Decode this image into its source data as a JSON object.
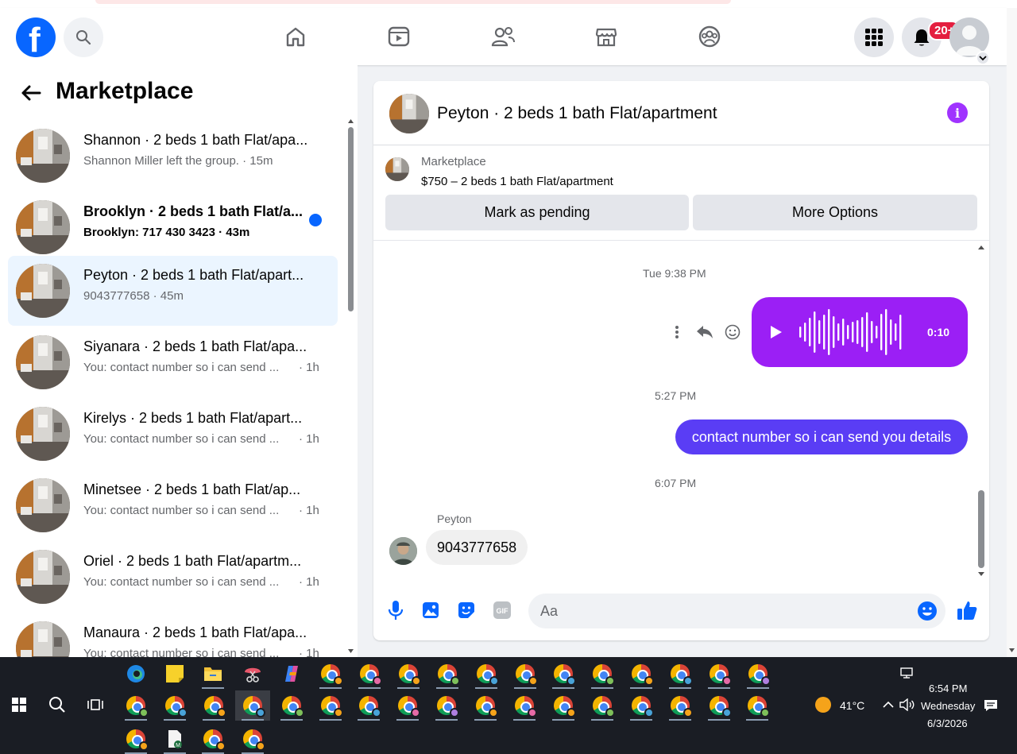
{
  "header": {
    "notifications_badge": "20+",
    "nav_items": [
      "home-icon",
      "video-icon",
      "friends-icon",
      "marketplace-icon",
      "groups-icon"
    ]
  },
  "left_panel": {
    "title": "Marketplace",
    "conversations": [
      {
        "name": "Shannon · 2 beds 1 bath Flat/apa...",
        "preview": "Shannon Miller left the group. · 15m",
        "time": "",
        "unread": false,
        "active": false
      },
      {
        "name": "Brooklyn · 2 beds 1 bath Flat/a...",
        "preview": "Brooklyn: 717 430 3423 · 43m",
        "time": "",
        "unread": true,
        "active": false
      },
      {
        "name": "Peyton · 2 beds 1 bath Flat/apart...",
        "preview": "9043777658 · 45m",
        "time": "",
        "unread": false,
        "active": true
      },
      {
        "name": "Siyanara · 2 beds 1 bath Flat/apa...",
        "preview": "You: contact number so i can send ...",
        "time": "· 1h",
        "unread": false,
        "active": false
      },
      {
        "name": "Kirelys · 2 beds 1 bath Flat/apart...",
        "preview": "You: contact number so i can send ...",
        "time": "· 1h",
        "unread": false,
        "active": false
      },
      {
        "name": "Minetsee · 2 beds 1 bath Flat/ap...",
        "preview": "You: contact number so i can send ...",
        "time": "· 1h",
        "unread": false,
        "active": false
      },
      {
        "name": "Oriel · 2 beds 1 bath Flat/apartm...",
        "preview": "You: contact number so i can send ...",
        "time": "· 1h",
        "unread": false,
        "active": false
      },
      {
        "name": "Manaura · 2 beds 1 bath Flat/apa...",
        "preview": "You: contact number so i can send ...",
        "time": "· 1h",
        "unread": false,
        "active": false
      }
    ]
  },
  "chat": {
    "title": "Peyton · 2 beds 1 bath Flat/apartment",
    "marketplace_label": "Marketplace",
    "listing": "$750 – 2 beds 1 bath Flat/apartment",
    "mark_pending_label": "Mark as pending",
    "more_options_label": "More Options",
    "messages": {
      "time1": "Tue 9:38 PM",
      "voice_duration": "0:10",
      "time2": "5:27 PM",
      "outgoing_text": "contact number so i can send you details",
      "time3": "6:07 PM",
      "sender": "Peyton",
      "incoming_text": "9043777658"
    },
    "composer_placeholder": "Aa",
    "gif_label": "GIF"
  },
  "taskbar": {
    "weather": "41°C",
    "time": "6:54 PM",
    "day": "Wednesday",
    "date": "6/3/2026"
  },
  "colors": {
    "facebook_blue": "#0866ff",
    "voice_bubble": "#9b1ff5",
    "outgoing_bubble": "#5a3df5",
    "badge_red": "#e41e3f"
  }
}
